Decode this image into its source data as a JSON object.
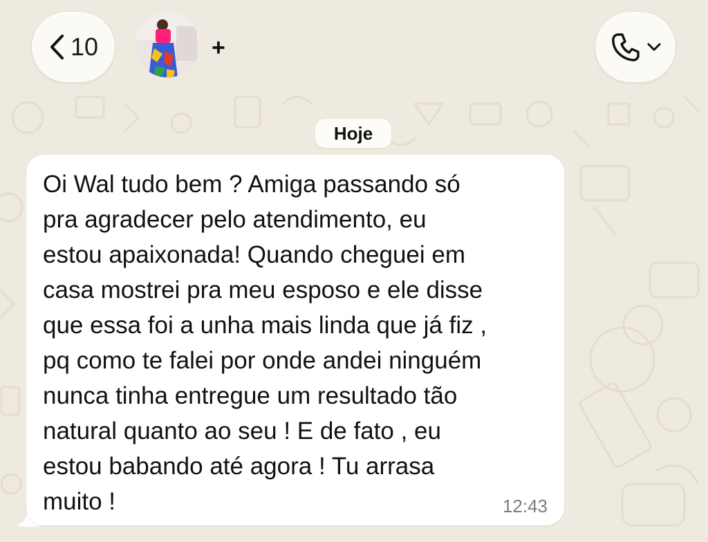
{
  "header": {
    "back_count": "10",
    "add_symbol": "+",
    "icons": {
      "back": "chevron-left-icon",
      "call": "phone-icon",
      "call_menu": "chevron-down-icon"
    }
  },
  "chat": {
    "date_label": "Hoje",
    "message": {
      "text": "Oi Wal tudo bem ? Amiga passando só\npra agradecer pelo atendimento, eu\nestou apaixonada! Quando cheguei  em\ncasa mostrei pra meu esposo e ele disse\nque essa foi a unha mais linda que já fiz ,\npq como te falei por onde andei ninguém\nnunca tinha entregue um resultado tão\nnatural quanto ao seu ! E de fato , eu\nestou babando até agora ! Tu arrasa\nmuito !",
      "time": "12:43"
    }
  },
  "colors": {
    "wallpaper": "#efeae0",
    "bubble": "#ffffff",
    "pill": "#fbfaf4"
  }
}
